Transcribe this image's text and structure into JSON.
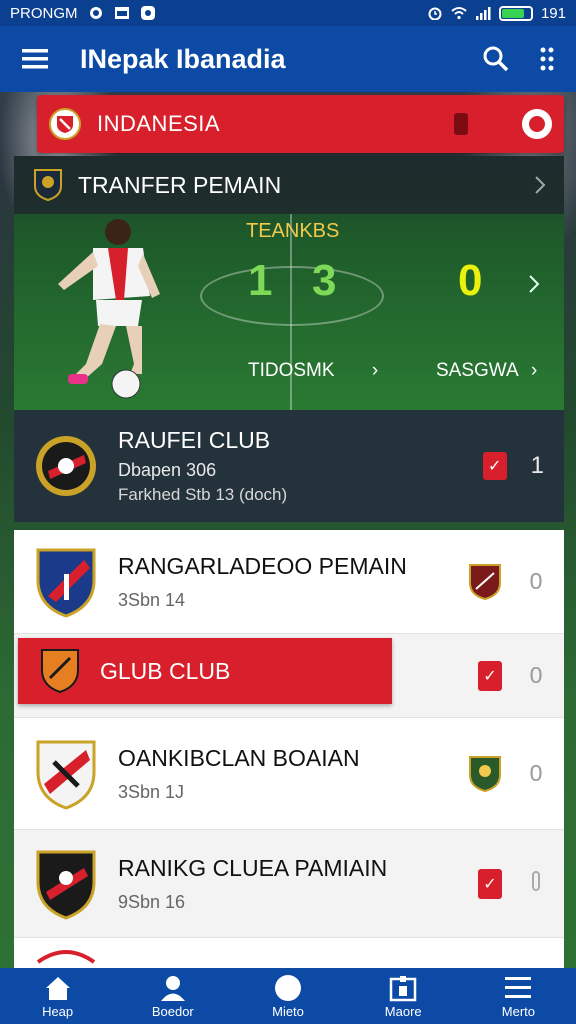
{
  "status": {
    "carrier": "PRONGM",
    "time": "191",
    "battery_level": 0.8
  },
  "app_bar": {
    "title": "INepak Ibanadia"
  },
  "country": {
    "name": "INDANESIA"
  },
  "hero": {
    "title": "TRANFER PEMAIN",
    "label": "TEANKBS",
    "score_a": "1",
    "score_b": "3",
    "score_c": "0",
    "link_left": "TIDOSMK",
    "link_right": "SASGWA"
  },
  "featured": {
    "name": "RAUFEI CLUB",
    "line1": "Dbapen 306",
    "line2": "Farkhed  Stb 13 (doch)",
    "count": "1"
  },
  "clubs": [
    {
      "name": "RANGARLADEOO PEMAIN",
      "sub": "3Sbn  14",
      "count": "0"
    },
    {
      "name": "GLUB CLUB",
      "sub": "",
      "count": "0"
    },
    {
      "name": "OANKIBCLAN BOAIAN",
      "sub": "3Sbn  1J",
      "count": "0"
    },
    {
      "name": "RANIKG CLUEA PAMIAIN",
      "sub": "9Sbn  16",
      "count": ""
    }
  ],
  "nav": {
    "home": "Heap",
    "profile": "Boedor",
    "ball": "Mieto",
    "match": "Maore",
    "menu": "Merto"
  },
  "colors": {
    "primary": "#0d4aa6",
    "accent": "#d8202c",
    "score_green": "#7ed957",
    "score_yellow": "#e9f20d"
  }
}
